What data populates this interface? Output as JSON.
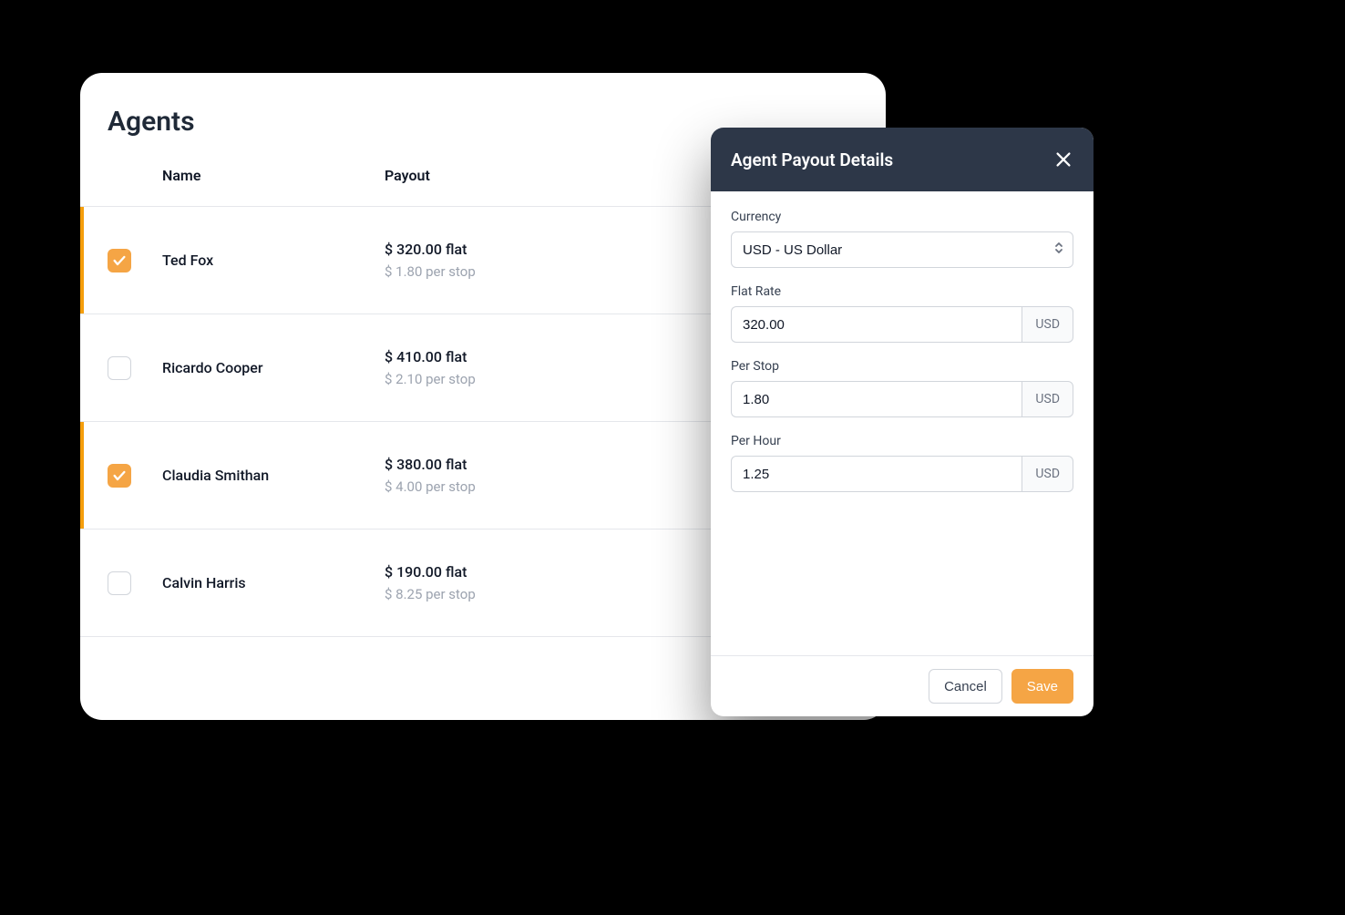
{
  "page": {
    "title": "Agents"
  },
  "table": {
    "headers": {
      "name": "Name",
      "payout": "Payout"
    },
    "rows": [
      {
        "selected": true,
        "name": "Ted Fox",
        "flat": "$ 320.00 flat",
        "per": "$ 1.80 per stop"
      },
      {
        "selected": false,
        "name": "Ricardo Cooper",
        "flat": "$ 410.00 flat",
        "per": "$ 2.10 per stop"
      },
      {
        "selected": true,
        "name": "Claudia Smithan",
        "flat": "$ 380.00 flat",
        "per": "$ 4.00 per stop"
      },
      {
        "selected": false,
        "name": "Calvin Harris",
        "flat": "$ 190.00 flat",
        "per": "$ 8.25 per stop"
      }
    ]
  },
  "panel": {
    "title": "Agent Payout Details",
    "currency": {
      "label": "Currency",
      "value": "USD - US Dollar"
    },
    "flat_rate": {
      "label": "Flat Rate",
      "value": "320.00",
      "suffix": "USD"
    },
    "per_stop": {
      "label": "Per Stop",
      "value": "1.80",
      "suffix": "USD"
    },
    "per_hour": {
      "label": "Per Hour",
      "value": "1.25",
      "suffix": "USD"
    },
    "cancel_label": "Cancel",
    "save_label": "Save"
  }
}
